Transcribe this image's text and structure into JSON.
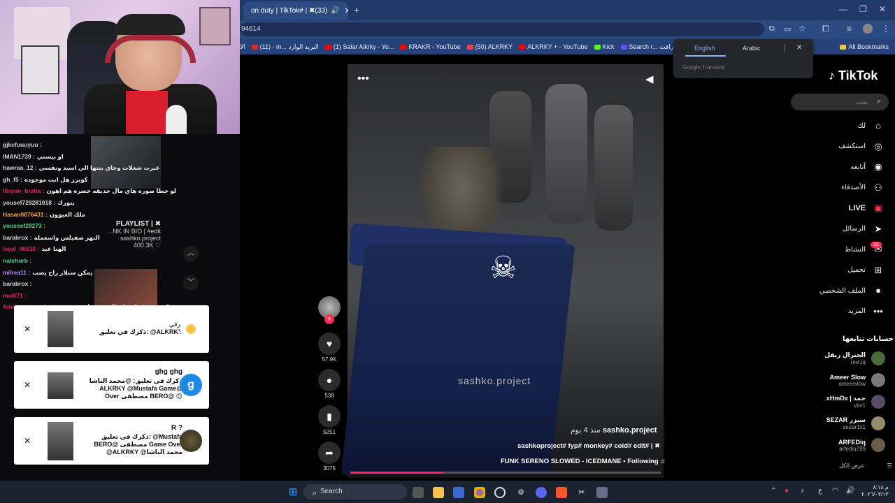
{
  "browser": {
    "tab_title": "on duty | TikTok# | ✖(33)",
    "address": "94614",
    "bookmarks": [
      "الا",
      "(11) - m... البريد الوارد",
      "(1) Salar Alkrky - Yo...",
      "KRAKR - YouTube",
      "(50) ALKRKY",
      "ALKRKY + - YouTube",
      "Kick",
      "Search r... رافت"
    ],
    "all_bookmarks": "All Bookmarks"
  },
  "translate": {
    "english": "English",
    "arabic": "Arabic",
    "footer": "Google Translate"
  },
  "tiktok": {
    "logo": "TikTok",
    "search_placeholder": "بحث",
    "nav": [
      {
        "label": "لك",
        "icon": "home-icon"
      },
      {
        "label": "استكشف",
        "icon": "compass-icon"
      },
      {
        "label": "أتابعه",
        "icon": "following-icon"
      },
      {
        "label": "الأصدقاء",
        "icon": "friends-icon"
      },
      {
        "label": "LIVE",
        "icon": "live-icon"
      },
      {
        "label": "الرسائل",
        "icon": "send-icon"
      },
      {
        "label": "النشاط",
        "icon": "inbox-icon"
      },
      {
        "label": "تحميل",
        "icon": "upload-icon"
      },
      {
        "label": "الملف الشخصي",
        "icon": "profile-icon"
      },
      {
        "label": "المزيد",
        "icon": "more-icon"
      }
    ],
    "activity_badge": "33",
    "following_heading": "حسابات تتابعها",
    "following": [
      {
        "name": "الجنرال ريفل",
        "handle": "revl.iq"
      },
      {
        "name": "Ameer Slow",
        "handle": "ameerslow"
      },
      {
        "name": "xHmDx | حمد",
        "handle": "vbv1"
      },
      {
        "name": "SEZAR سيزر",
        "handle": "sezar1x1"
      },
      {
        "name": "ARFEDiq",
        "handle": "arfediq799"
      }
    ],
    "see_all": "عرض الكل",
    "video": {
      "author": "sashko.project",
      "time": "منذ 4 يوم",
      "caption": "sashkoproject# fyp# monkey# cold# edit# | ✖",
      "music": "FUNK SERENO SLOWED - ICEDMANE • Following",
      "watermark": "sashko.project",
      "progress": 0.3
    },
    "actions": {
      "likes": "57.9K",
      "comments": "538",
      "saves": "5251",
      "shares": "3075"
    }
  },
  "chat": [
    {
      "user": "gjkcfuuuyuu :",
      "msg": "",
      "color": "#d6d6d6"
    },
    {
      "user": "IMAN1739 :",
      "msg": "او بيستي",
      "color": "#d6d6d6"
    },
    {
      "user": "hawraa_12 :",
      "msg": "عبرت شغلات وجاي بنتها الي اسيد ونفسي",
      "color": "#d6d6d6"
    },
    {
      "user": "gh_f5 :",
      "msg": "كوبرز هل انت موجوده",
      "color": "#d6d6d6"
    },
    {
      "user": "lilayan_braha :",
      "msg": "لو حطا صوره هاي مال حديقه خضره هم اهون",
      "color": "#e0245e"
    },
    {
      "user": "yousef728281018 :",
      "msg": "بتورك",
      "color": "#d6d6d6"
    },
    {
      "user": "Hasan0876431 :",
      "msg": "ملك العيوون",
      "color": "#f0a040"
    },
    {
      "user": "youssef28273 :",
      "msg": "",
      "color": "#4fd08a"
    },
    {
      "user": "barabrox :",
      "msg": "النهر صفيلس واسعمله",
      "color": "#d6d6d6"
    },
    {
      "user": "layal_46810 :",
      "msg": "الهنا عيد",
      "color": "#e0245e"
    },
    {
      "user": "nalehurb :",
      "msg": "",
      "color": "#4fd08a"
    },
    {
      "user": "milrea11 :",
      "msg": "يمكن ستلار راح يصب",
      "color": "#b78cff"
    },
    {
      "user": "barabrox :",
      "msg": "",
      "color": "#d6d6d6"
    },
    {
      "user": "mal671 :",
      "msg": "",
      "color": "#e0245e"
    },
    {
      "user": "Amintra_iq :",
      "msg": "كرني منتسك على الهبوت عليه تنه روح شوقه",
      "color": "#e0245e"
    }
  ],
  "playlist": {
    "title": "PLAYLIST | ✖",
    "line2": "...NK IN BIO | #edit",
    "author": "sashko.project",
    "stats": "400.3K ♡"
  },
  "notifications": [
    {
      "title": "برقي",
      "line1": "ذكرك في تعليق: @ALKRKY",
      "line2": "",
      "line3": ""
    },
    {
      "title": "ghg ghg",
      "line1": "ذكرك في تعليق: @محمد الباشا",
      "line2": "ALKRKY @Mustafa Game@",
      "line3": "Over مصطفى BERO@ 😍"
    },
    {
      "title": "R ?",
      "line1": "ذكرك في تعليق: @Mustafa",
      "line2": "BERO@ مصطفى Game Over",
      "line3": "@ALKRKY @محمد الباشا"
    }
  ],
  "taskbar": {
    "search": "Search",
    "time": "م ٨:١٨",
    "date": "٢٠٢٦/٠٣/١٣"
  },
  "colors": {
    "accent": "#fe2c55",
    "tabbar": "#1f3a68"
  }
}
